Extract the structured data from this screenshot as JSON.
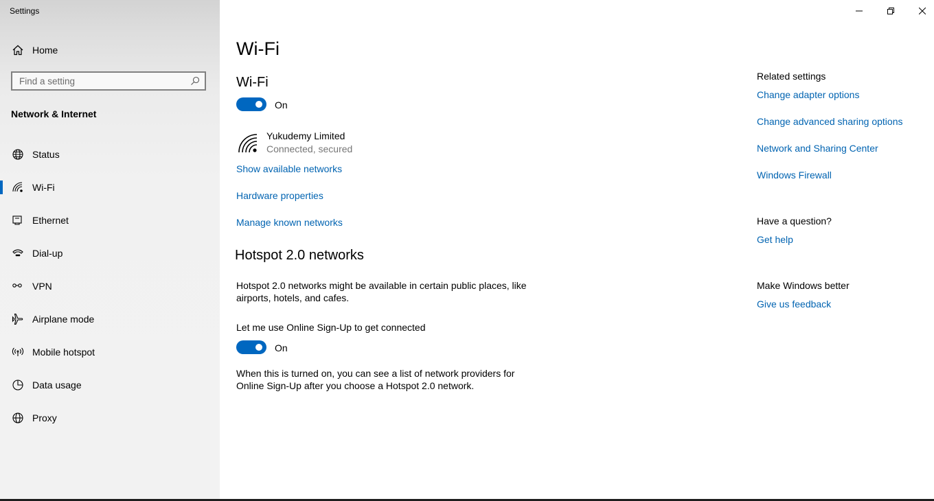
{
  "window": {
    "title": "Settings",
    "controls": {
      "minimize": "minimize-icon",
      "restore": "restore-icon",
      "close": "close-icon"
    }
  },
  "sidebar": {
    "home_label": "Home",
    "search_placeholder": "Find a setting",
    "section_title": "Network & Internet",
    "items": [
      {
        "label": "Status",
        "icon": "globe-icon"
      },
      {
        "label": "Wi-Fi",
        "icon": "wifi-icon",
        "active": true
      },
      {
        "label": "Ethernet",
        "icon": "ethernet-icon"
      },
      {
        "label": "Dial-up",
        "icon": "dialup-icon"
      },
      {
        "label": "VPN",
        "icon": "vpn-icon"
      },
      {
        "label": "Airplane mode",
        "icon": "airplane-icon"
      },
      {
        "label": "Mobile hotspot",
        "icon": "hotspot-icon"
      },
      {
        "label": "Data usage",
        "icon": "data-usage-icon"
      },
      {
        "label": "Proxy",
        "icon": "proxy-globe-icon"
      }
    ]
  },
  "main": {
    "page_title": "Wi-Fi",
    "wifi_heading": "Wi-Fi",
    "wifi_toggle_state": "On",
    "network": {
      "name": "Yukudemy Limited",
      "status": "Connected, secured"
    },
    "links": [
      "Show available networks",
      "Hardware properties",
      "Manage known networks"
    ],
    "hotspot": {
      "heading": "Hotspot 2.0 networks",
      "description": "Hotspot 2.0 networks might be available in certain public places, like airports, hotels, and cafes.",
      "signup_label": "Let me use Online Sign-Up to get connected",
      "signup_toggle_state": "On",
      "signup_note": "When this is turned on, you can see a list of network providers for Online Sign-Up after you choose a Hotspot 2.0 network."
    }
  },
  "related": {
    "heading": "Related settings",
    "links": [
      "Change adapter options",
      "Change advanced sharing options",
      "Network and Sharing Center",
      "Windows Firewall"
    ],
    "question_heading": "Have a question?",
    "help_link": "Get help",
    "better_heading": "Make Windows better",
    "feedback_link": "Give us feedback"
  },
  "colors": {
    "accent": "#0067c0",
    "link": "#0063b1",
    "sidebar_bg": "#f2f2f2"
  }
}
